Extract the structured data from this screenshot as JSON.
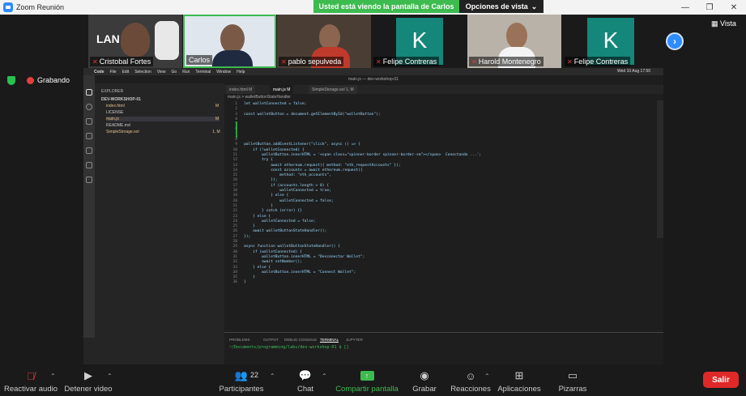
{
  "window": {
    "title": "Zoom Reunión",
    "share_banner": "Usted está viendo la pantalla de Carlos",
    "view_options": "Opciones de vista"
  },
  "participants": [
    {
      "name": "Cristobal Fortes",
      "muted": true
    },
    {
      "name": "Carlos",
      "muted": false
    },
    {
      "name": "pablo sepulveda",
      "muted": true
    },
    {
      "name": "Felipe Contreras",
      "muted": true,
      "avatar_letter": "K"
    },
    {
      "name": "Harold Montenegro",
      "muted": true
    },
    {
      "name": "Felipe Contreras",
      "muted": true,
      "avatar_letter": "K"
    }
  ],
  "vista_label": "Vista",
  "recording_label": "Grabando",
  "shared_screen": {
    "mac_menu": [
      "Code",
      "File",
      "Edit",
      "Selection",
      "View",
      "Go",
      "Run",
      "Terminal",
      "Window",
      "Help"
    ],
    "clock": "Wed 10 Aug 17:50",
    "window_title": "main.js — dev-workshop-01",
    "explorer": {
      "header": "EXPLORER",
      "folder": "DEV-WORKSHOP-01",
      "files": [
        {
          "name": "index.html",
          "badge": "M"
        },
        {
          "name": "LICENSE",
          "badge": ""
        },
        {
          "name": "main.js",
          "badge": "M"
        },
        {
          "name": "README.md",
          "badge": ""
        },
        {
          "name": "SimpleStorage.sol",
          "badge": "1, M"
        }
      ]
    },
    "tabs": [
      "index.html M",
      "main.js M",
      "SimpleStorage.sol 1, M"
    ],
    "breadcrumb": "main.js > walletButtonStateHandler",
    "code_lines": [
      "let walletConnected = false;",
      "",
      "const walletButton = document.getElementById(\"walletButton\");",
      "",
      "",
      "",
      "",
      "",
      "walletButton.addEventListener(\"click\", async () => {",
      "    if (!walletConnected) {",
      "        walletButton.innerHTML = '<span class=\"spinner-border spinner-border-sm\"></span>  Conectando ...';",
      "        try {",
      "            await ethereum.request({ method: \"eth_requestAccounts\" });",
      "            const accounts = await ethereum.request({",
      "                method: \"eth_accounts\",",
      "            });",
      "            if (accounts.length > 0) {",
      "                walletConnected = true;",
      "            } else {",
      "                walletConnected = false;",
      "            }",
      "        } catch (error) {}",
      "    } else {",
      "        walletConnected = false;",
      "    }",
      "    await walletButtonStateHandler();",
      "});",
      "",
      "async function walletButtonStateHandler() {",
      "    if (walletConnected) {",
      "        walletButton.innerHTML = \"Desconectar Wallet\";",
      "        await setNumber();",
      "    } else {",
      "        walletButton.innerHTML = \"Connect Wallet\";",
      "    }",
      "}"
    ],
    "panel_tabs": [
      "PROBLEMS",
      "OUTPUT",
      "DEBUG CONSOLE",
      "TERMINAL",
      "JUPYTER"
    ],
    "active_panel_tab": "TERMINAL",
    "terminal_prompt": "~/Documents/programming/labs/dev-workshop-01 $ []"
  },
  "toolbar": {
    "audio": "Reactivar audio",
    "video": "Detener video",
    "participants": "Participantes",
    "participant_count": "22",
    "chat": "Chat",
    "share": "Compartir pantalla",
    "record": "Grabar",
    "reactions": "Reacciones",
    "apps": "Aplicaciones",
    "whiteboards": "Pizarras",
    "exit": "Salir"
  }
}
